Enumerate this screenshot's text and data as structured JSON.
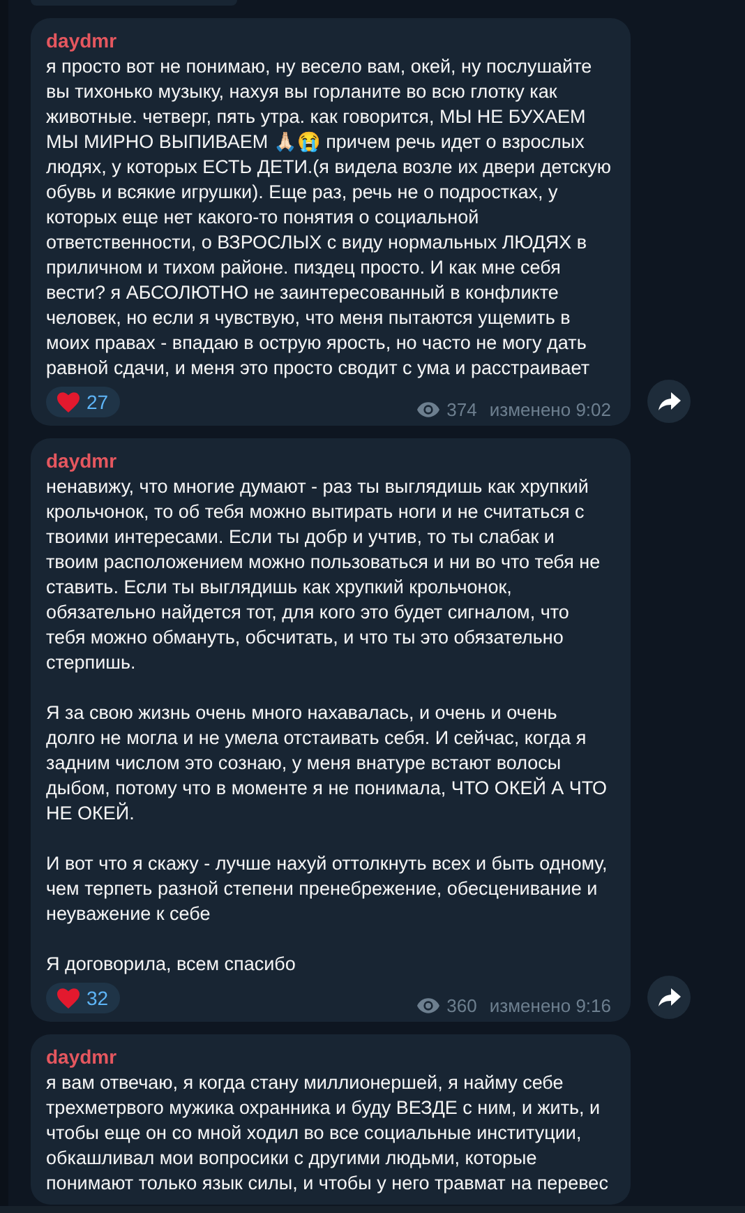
{
  "messages": [
    {
      "author": "daydmr",
      "paragraphs": [
        "я просто вот не понимаю, ну весело вам, окей, ну послушайте вы тихонько музыку, нахуя вы горланите во всю глотку как животные. четверг, пять утра. как говорится, МЫ НЕ БУХАЕМ МЫ МИРНО ВЫПИВАЕМ 🙏🏻😭 причем речь идет о взрослых людях, у которых ЕСТЬ ДЕТИ.(я видела возле их двери детскую обувь и всякие игрушки). Еще раз, речь не о подростках, у которых еще нет какого-то понятия о социальной ответственности, о ВЗРОСЛЫХ с виду нормальных ЛЮДЯХ в приличном и тихом районе. пиздец просто. И как мне себя вести? я АБСОЛЮТНО не заинтересованный в конфликте человек, но если я чувствую, что меня пытаются ущемить в моих правах - впадаю в острую ярость, но часто не могу дать равной сдачи, и меня это просто сводит с ума и расстраивает"
      ],
      "reaction_count": "27",
      "views": "374",
      "edited": "изменено 9:02"
    },
    {
      "author": "daydmr",
      "paragraphs": [
        "ненавижу, что многие думают - раз ты выглядишь как хрупкий крольчонок, то об тебя можно вытирать ноги и не считаться с твоими интересами. Если ты добр и учтив, то ты слабак и твоим расположением можно пользоваться и ни во что тебя не ставить. Если ты выглядишь как хрупкий крольчонок, обязательно найдется тот, для кого это будет сигналом, что тебя можно обмануть, обсчитать, и что ты это обязательно стерпишь.",
        "Я за свою жизнь очень много нахавалась, и очень и очень долго не могла и не умела отстаивать себя. И сейчас, когда я задним числом это сознаю, у меня внатуре встают волосы дыбом, потому что в моменте я не понимала, ЧТО ОКЕЙ А ЧТО НЕ ОКЕЙ.",
        "И вот что я скажу - лучше нахуй оттолкнуть всех и быть одному, чем терпеть разной степени  пренебрежение, обесценивание и неуважение к себе",
        "Я договорила, всем спасибо"
      ],
      "reaction_count": "32",
      "views": "360",
      "edited": "изменено 9:16"
    },
    {
      "author": "daydmr",
      "paragraphs": [
        "я вам отвечаю, я когда стану миллионершей, я найму себе трехметрвого мужика охранника и буду ВЕЗДЕ с ним, и жить, и чтобы еще он со мной ходил во все социальные институции, обкашливал мои вопросики с другими людьми, которые понимают только язык силы, и чтобы у него травмат на перевес"
      ]
    }
  ]
}
